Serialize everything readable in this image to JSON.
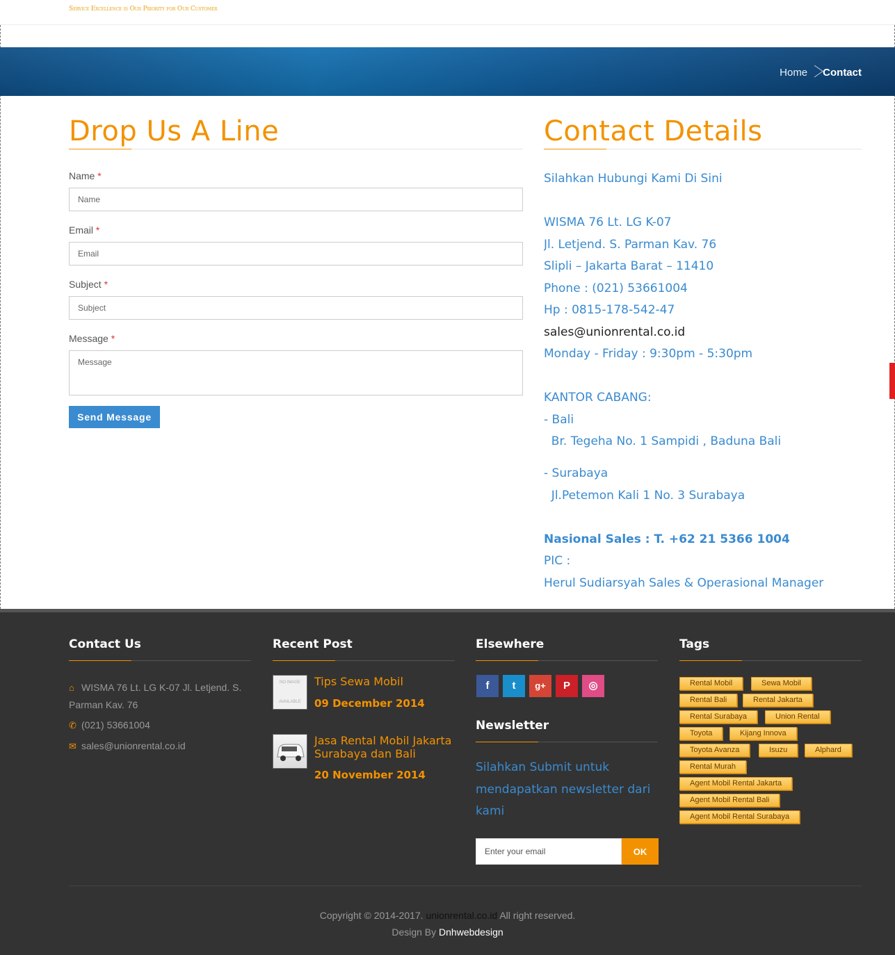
{
  "header": {
    "tagline": "Service Excellence is Our Priority for Our Customer"
  },
  "breadcrumb": {
    "home": "Home",
    "current": "Contact"
  },
  "form_section": {
    "title": "Drop Us A Line",
    "fields": {
      "name": {
        "label": "Name",
        "placeholder": "Name"
      },
      "email": {
        "label": "Email",
        "placeholder": "Email"
      },
      "subject": {
        "label": "Subject",
        "placeholder": "Subject"
      },
      "message": {
        "label": "Message",
        "placeholder": "Message"
      }
    },
    "required_mark": "*",
    "submit_label": "Send Message"
  },
  "contact_details": {
    "title": "Contact Details",
    "intro": "Silahkan Hubungi Kami Di Sini",
    "address1": "WISMA 76 Lt. LG K-07",
    "address2": "Jl. Letjend. S. Parman Kav. 76",
    "address3": "Slipli – Jakarta Barat – 11410",
    "phone": "Phone : (021) 53661004",
    "hp": "Hp : 0815-178-542-47",
    "email": "sales@unionrental.co.id",
    "hours": "Monday - Friday : 9:30pm - 5:30pm",
    "branch_title": "KANTOR CABANG:",
    "branch_bali": "- Bali",
    "branch_bali_addr": "  Br. Tegeha No. 1 Sampidi , Baduna Bali",
    "branch_surabaya": "- Surabaya",
    "branch_surabaya_addr": "  Jl.Petemon Kali 1 No. 3 Surabaya",
    "national_sales": "Nasional Sales : T. +62 21 5366 1004",
    "pic_label": "PIC :",
    "pic_name": "Herul Sudiarsyah Sales & Operasional Manager"
  },
  "footer": {
    "contact": {
      "title": "Contact Us",
      "address": "WISMA 76 Lt. LG K-07 Jl. Letjend. S. Parman Kav. 76",
      "phone": "(021) 53661004",
      "email": "sales@unionrental.co.id"
    },
    "recent": {
      "title": "Recent Post",
      "posts": [
        {
          "title": "Tips Sewa Mobil",
          "date": "09 December 2014"
        },
        {
          "title": "Jasa Rental Mobil Jakarta Surabaya dan Bali",
          "date": "20 November 2014"
        }
      ]
    },
    "elsewhere": {
      "title": "Elsewhere",
      "socials": [
        {
          "icon": "facebook-icon",
          "glyph": "f",
          "color": "#3b5998"
        },
        {
          "icon": "twitter-icon",
          "glyph": "t",
          "color": "#1a8ecb"
        },
        {
          "icon": "google-plus-icon",
          "glyph": "g+",
          "color": "#d54535"
        },
        {
          "icon": "pinterest-icon",
          "glyph": "P",
          "color": "#cb2027"
        },
        {
          "icon": "dribbble-icon",
          "glyph": "◎",
          "color": "#e04c86"
        }
      ]
    },
    "newsletter": {
      "title": "Newsletter",
      "text": "Silahkan Submit untuk mendapatkan newsletter dari kami",
      "placeholder": "Enter your email",
      "button": "OK"
    },
    "tags": {
      "title": "Tags",
      "items": [
        "Rental Mobil",
        "Sewa Mobil",
        "Rental Bali",
        "Rental Jakarta",
        "Rental Surabaya",
        "Union Rental",
        "Toyota",
        "Kijang Innova",
        "Toyota Avanza",
        "Isuzu",
        "Alphard",
        "Rental Murah",
        "Agent Mobil Rental Jakarta",
        "Agent Mobil Rental Bali",
        "Agent Mobil Rental Surabaya"
      ]
    },
    "copyright_prefix": "Copyright © 2014-2017.",
    "copyright_site": "unionrental.co.id",
    "copyright_suffix": "All right reserved.",
    "design_prefix": "Design By",
    "designer": "Dnhwebdesign"
  },
  "colors": {
    "accent": "#f39200",
    "link_blue": "#3a8bd0",
    "footer_bg": "#333333"
  }
}
